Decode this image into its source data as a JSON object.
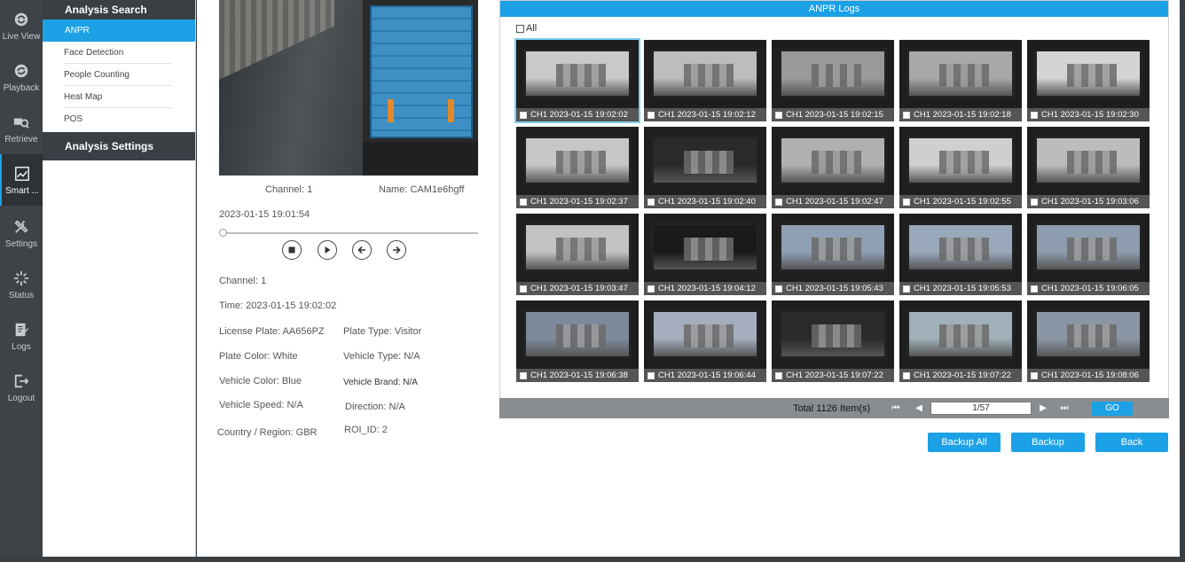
{
  "rail": {
    "items": [
      {
        "label": "Live View",
        "icon": "live-view-icon"
      },
      {
        "label": "Playback",
        "icon": "playback-icon"
      },
      {
        "label": "Retrieve",
        "icon": "retrieve-icon"
      },
      {
        "label": "Smart ...",
        "icon": "smart-analysis-icon"
      },
      {
        "label": "Settings",
        "icon": "settings-icon"
      },
      {
        "label": "Status",
        "icon": "status-icon"
      },
      {
        "label": "Logs",
        "icon": "logs-icon"
      },
      {
        "label": "Logout",
        "icon": "logout-icon"
      }
    ]
  },
  "submenu": {
    "header": "Analysis Search",
    "items": [
      "ANPR",
      "Face Detection",
      "People Counting",
      "Heat Map",
      "POS"
    ],
    "settings_header": "Analysis Settings"
  },
  "video": {
    "channel": "Channel: 1",
    "name": "Name: CAM1e6hgff",
    "timestamp": "2023-01-15 19:01:54"
  },
  "details": {
    "channel": "Channel: 1",
    "time": "Time: 2023-01-15 19:02:02",
    "license_plate": "License Plate: AA656PZ",
    "plate_type": "Plate Type: Visitor",
    "plate_color": "Plate Color: White",
    "vehicle_type": "Vehicle Type: N/A",
    "vehicle_color": "Vehicle Color: Blue",
    "vehicle_brand": "Vehicle Brand:  N/A",
    "vehicle_speed": "Vehicle Speed: N/A",
    "direction": "Direction: N/A",
    "country_region": "Country / Region: GBR",
    "roi_id": "ROI_ID: 2"
  },
  "logs": {
    "title": "ANPR Logs",
    "all_label": "All",
    "captions": [
      "CH1 2023-01-15 19:02:02",
      "CH1 2023-01-15 19:02:12",
      "CH1 2023-01-15 19:02:15",
      "CH1 2023-01-15 19:02:18",
      "CH1 2023-01-15 19:02:30",
      "CH1 2023-01-15 19:02:37",
      "CH1 2023-01-15 19:02:40",
      "CH1 2023-01-15 19:02:47",
      "CH1 2023-01-15 19:02:55",
      "CH1 2023-01-15 19:03:06",
      "CH1 2023-01-15 19:03:47",
      "CH1 2023-01-15 19:04:12",
      "CH1 2023-01-15 19:05:43",
      "CH1 2023-01-15 19:05:53",
      "CH1 2023-01-15 19:06:05",
      "CH1 2023-01-15 19:06:38",
      "CH1 2023-01-15 19:06:44",
      "CH1 2023-01-15 19:07:22",
      "CH1 2023-01-15 19:07:22",
      "CH1 2023-01-15 19:08:06"
    ],
    "tile_colors": [
      "#c9c9c9",
      "#bdbdbd",
      "#9a9a9a",
      "#a8a8a8",
      "#d4d4d4",
      "#c6c6c6",
      "#2a2a2a",
      "#b0b0b0",
      "#cfcfcf",
      "#bcbcbc",
      "#c2c2c2",
      "#1a1a1a",
      "#8fa0b4",
      "#9aa8bc",
      "#8e9cb0",
      "#7e8a9c",
      "#a4aebe",
      "#2a2a2a",
      "#9fb0b8",
      "#8a96a6"
    ]
  },
  "pager": {
    "total": "Total 1126 Item(s)",
    "first": "⏮",
    "prev": "◀",
    "page": "1/57",
    "next": "▶",
    "last": "⏭",
    "go": "GO"
  },
  "actions": {
    "backup_all": "Backup All",
    "backup": "Backup",
    "back": "Back"
  },
  "colors": {
    "accent": "#1da1e6",
    "rail_bg": "#3e4347"
  }
}
